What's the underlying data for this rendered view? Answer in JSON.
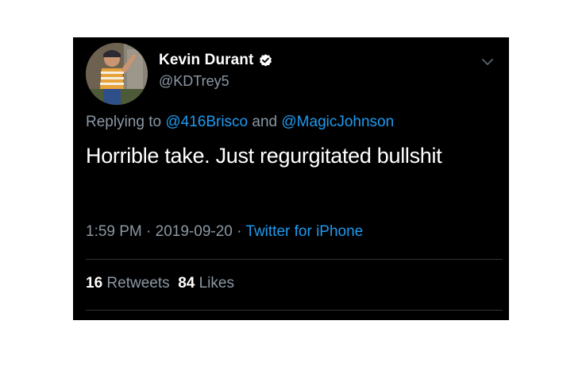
{
  "author": {
    "display_name": "Kevin Durant",
    "handle": "@KDTrey5",
    "verified": true,
    "verified_icon": "verified-badge-icon"
  },
  "reply": {
    "prefix": "Replying to",
    "mention_1": "@416Brisco",
    "conjunction": "and",
    "mention_2": "@MagicJohnson"
  },
  "tweet": {
    "text": "Horrible take. Just regurgitated bullshit"
  },
  "meta": {
    "time": "1:59 PM",
    "separator": "·",
    "date": "2019-09-20",
    "source": "Twitter for iPhone"
  },
  "stats": {
    "retweets_count": "16",
    "retweets_label": "Retweets",
    "likes_count": "84",
    "likes_label": "Likes"
  },
  "menu_icon": "chevron-down-icon",
  "colors": {
    "background": "#000000",
    "text": "#ffffff",
    "secondary": "#8b98a5",
    "accent": "#1d9bf0"
  }
}
